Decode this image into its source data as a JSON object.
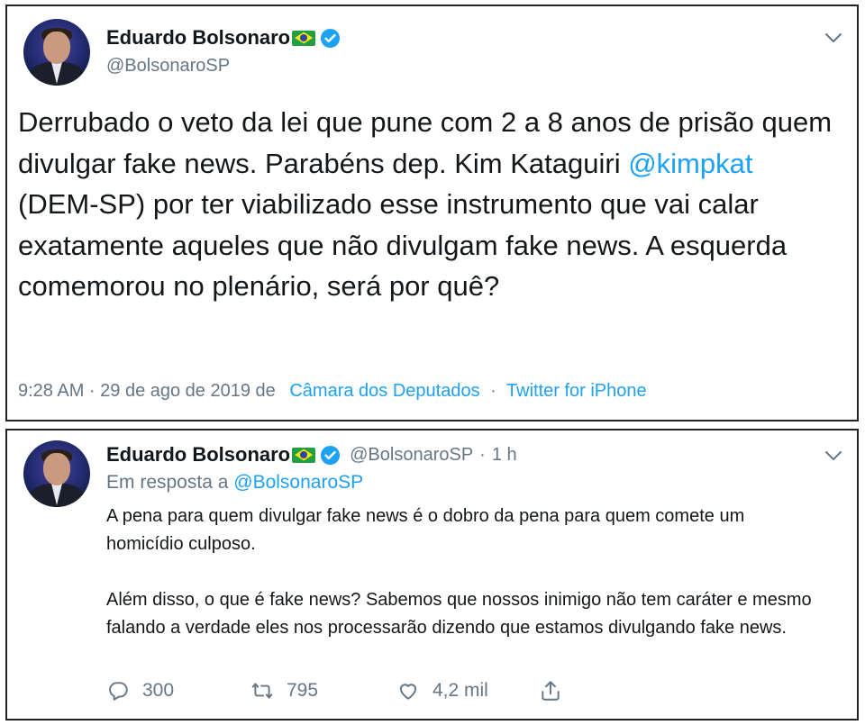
{
  "tweet": {
    "author_name": "Eduardo Bolsonaro",
    "handle": "@BolsonaroSP",
    "text_before_link": "Derrubado o veto da lei que pune com 2 a 8 anos de prisão quem divulgar fake news. Parabéns dep. Kim Kataguiri ",
    "link": "@kimpkat",
    "text_after_link": " (DEM-SP) por ter viabilizado esse instrumento que vai calar exatamente aqueles que não divulgam fake news. A esquerda comemorou no plenário, será por quê?",
    "timestamp": "9:28 AM · 29 de ago de 2019 de",
    "location": "Câmara dos Deputados",
    "separator": "·",
    "source": "Twitter for iPhone"
  },
  "reply": {
    "author_name": "Eduardo Bolsonaro",
    "handle": "@BolsonaroSP",
    "time_sep": "·",
    "time": "1 h",
    "reply_prefix": "Em resposta a",
    "reply_handle": "@BolsonaroSP",
    "paragraph_1": "A pena para quem divulgar fake news é o dobro da pena para quem comete um homicídio culposo.",
    "paragraph_2": "Além disso, o que é fake news? Sabemos que nossos inimigo não tem caráter e mesmo falando a verdade eles nos processarão dizendo que estamos divulgando fake news.",
    "actions": {
      "replies": "300",
      "retweets": "795",
      "likes": "4,2 mil"
    }
  },
  "icons": {
    "verified": "verified-badge-icon",
    "flag": "brazil-flag-icon",
    "chevron": "chevron-down-icon",
    "reply": "reply-icon",
    "retweet": "retweet-icon",
    "like": "heart-icon",
    "share": "share-icon"
  },
  "colors": {
    "accent": "#1da1f2",
    "secondary_text": "#657786",
    "primary_text": "#14171a"
  }
}
